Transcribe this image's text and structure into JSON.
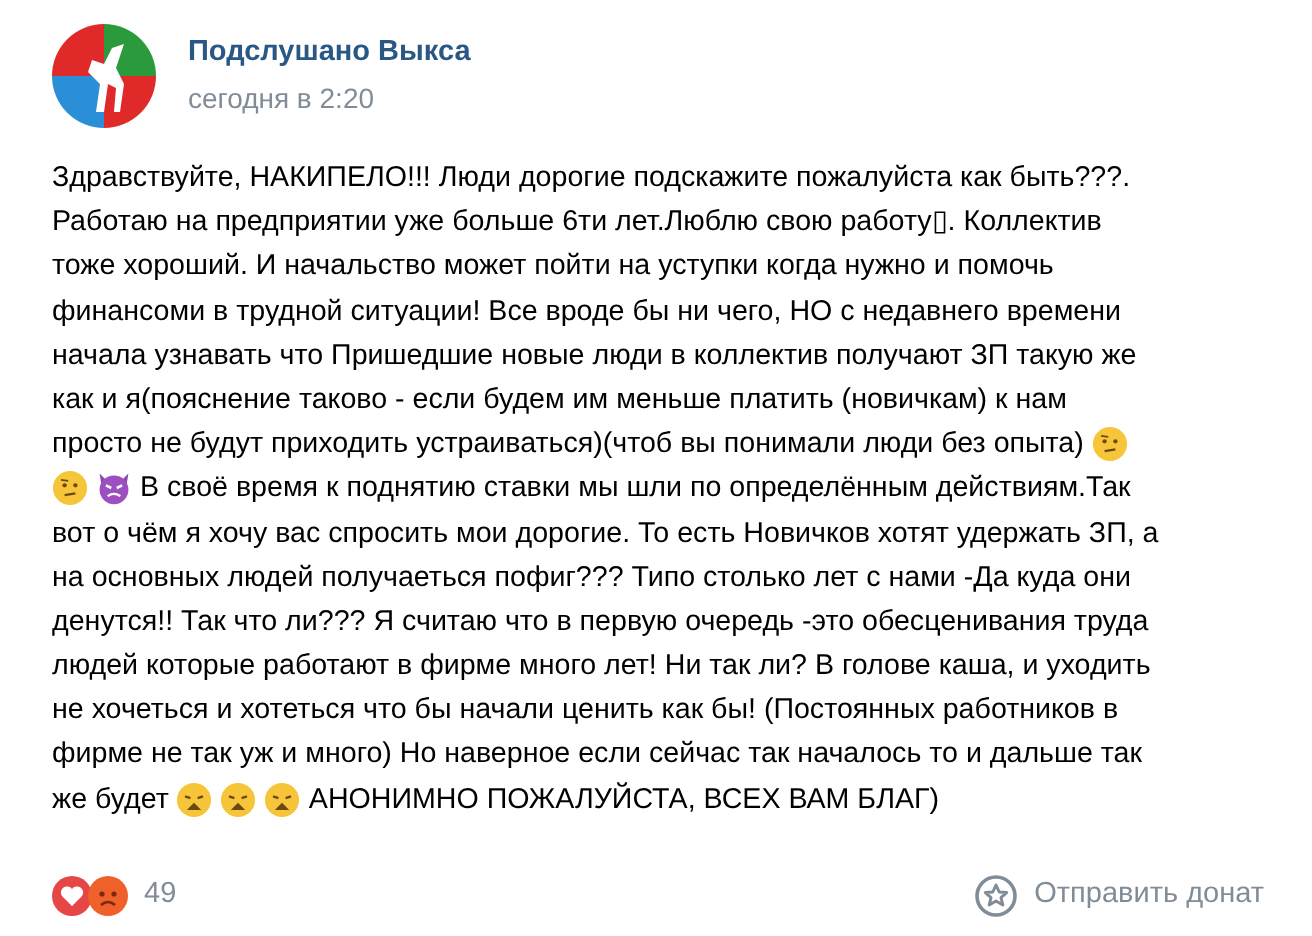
{
  "post": {
    "author": "Подслушано Выкса",
    "time": "сегодня в 2:20",
    "lines": [
      [
        {
          "kind": "text",
          "text": "Здравствуйте, НАКИПЕЛО!!! Люди дорогие подскажите пожалуйста как быть???."
        }
      ],
      [
        {
          "kind": "text",
          "text": "Работаю на предприятии уже больше 6ти лет.Люблю свою работу▯. Коллектив"
        }
      ],
      [
        {
          "kind": "text",
          "text": "тоже хороший. И начальство может пойти на уступки когда нужно и помочь"
        }
      ],
      [
        {
          "kind": "text",
          "text": "финансоми в трудной ситуации! Все вроде бы ни чего, НО с недавнего времени"
        }
      ],
      [
        {
          "kind": "text",
          "text": "начала узнавать что Пришедшие новые люди в коллектив получают ЗП такую же"
        }
      ],
      [
        {
          "kind": "text",
          "text": "как и я(пояснение таково - если будем им меньше платить (новичкам) к нам"
        }
      ],
      [
        {
          "kind": "text",
          "text": "просто не будут приходить устраиваться)(чтоб вы понимали люди без опыта)"
        },
        {
          "kind": "doubt"
        }
      ],
      [
        {
          "kind": "doubt"
        },
        {
          "kind": "devil"
        },
        {
          "kind": "text",
          "text": "В своё время к поднятию ставки мы шли по определённым действиям.Так"
        }
      ],
      [
        {
          "kind": "text",
          "text": "вот о чём я хочу вас спросить мои дорогие. То есть Новичков хотят удержать ЗП, а"
        }
      ],
      [
        {
          "kind": "text",
          "text": "на основных людей получаеться пофиг??? Типо столько лет с нами -Да куда они"
        }
      ],
      [
        {
          "kind": "text",
          "text": "денутся!! Так что ли??? Я считаю что в первую очередь -это обесценивания труда"
        }
      ],
      [
        {
          "kind": "text",
          "text": "людей которые работают в фирме много лет! Ни так ли? В голове каша, и уходить"
        }
      ],
      [
        {
          "kind": "text",
          "text": "не хочеться и хотеться что бы начали ценить как бы! (Постоянных работников в"
        }
      ],
      [
        {
          "kind": "text",
          "text": "фирме не так уж и много) Но наверное если сейчас так началось то и дальше так"
        }
      ],
      [
        {
          "kind": "text",
          "text": "же будет"
        },
        {
          "kind": "weary"
        },
        {
          "kind": "weary"
        },
        {
          "kind": "weary"
        },
        {
          "kind": "text",
          "text": "АНОНИМНО ПОЖАЛУЙСТА, ВСЕХ ВАМ БЛАГ)"
        }
      ]
    ],
    "likes": "49",
    "donate": "Отправить донат"
  }
}
